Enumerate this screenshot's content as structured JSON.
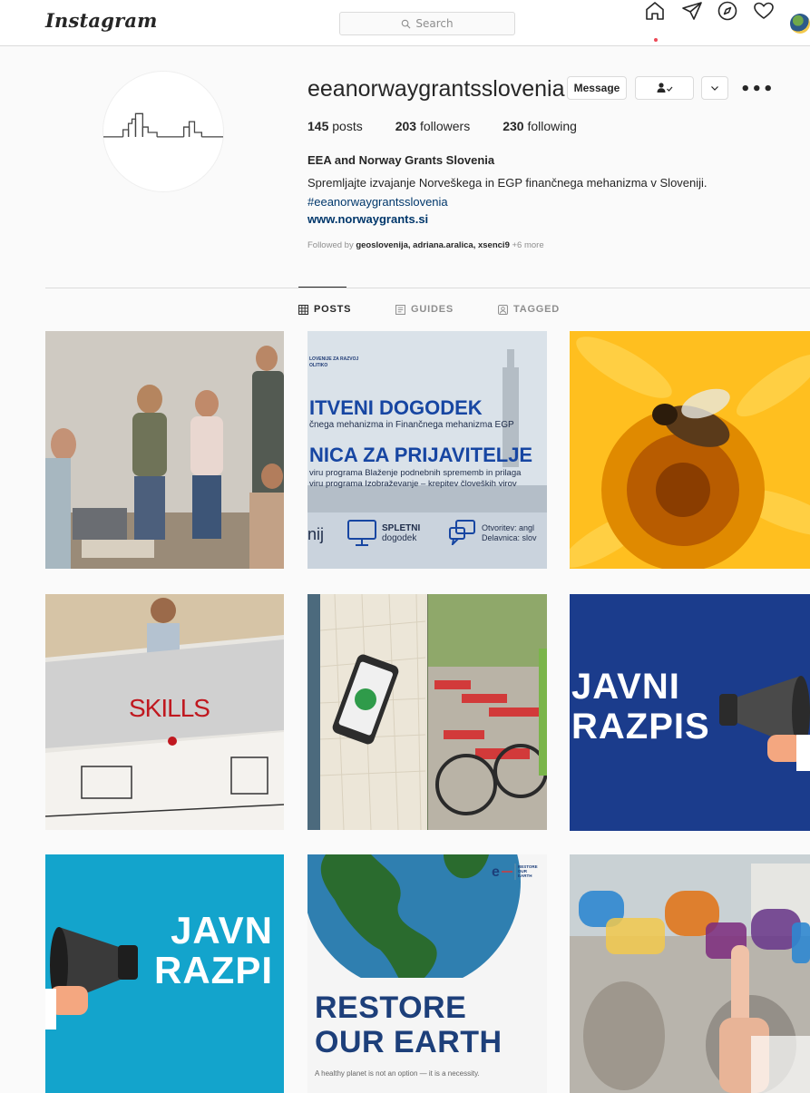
{
  "nav": {
    "logo": "Instagram",
    "search_placeholder": "Search"
  },
  "profile": {
    "username": "eeanorwaygrantsslovenia",
    "message_label": "Message",
    "posts_count": "145",
    "posts_label": "posts",
    "followers_count": "203",
    "followers_label": "followers",
    "following_count": "230",
    "following_label": "following",
    "full_name": "EEA and Norway Grants Slovenia",
    "bio_line": "Spremljajte izvajanje Norveškega in EGP finančnega mehanizma v Sloveniji.",
    "hashtag": "#eeanorwaygrantsslovenia",
    "website": "www.norwaygrants.si",
    "followed_by_prefix": "Followed by",
    "followed_by_users": "geoslovenija, adriana.aralica, xsenci9",
    "followed_by_more": "+6 more"
  },
  "tabs": [
    {
      "label": "POSTS",
      "active": true
    },
    {
      "label": "GUIDES",
      "active": false
    },
    {
      "label": "TAGGED",
      "active": false
    }
  ],
  "posts": {
    "p2": {
      "small": "LOVENIJE ZA RAZVOJ OLITIKO",
      "h1": "ITVENI DOGODEK",
      "s1": "čnega mehanizma in Finančnega mehanizma EGP",
      "h2": "NICA ZA PRIJAVITELJE",
      "s2a": "viru programa Blaženje podnebnih sprememb in prilaga",
      "s2b": "viru programa Izobraževanje – krepitev človeških virov",
      "b0": "nij",
      "b1a": "SPLETNI",
      "b1b": "dogodek",
      "b2a": "Otvoritev: angl",
      "b2b": "Delavnica: slov"
    },
    "p4": {
      "text": "SKILLS"
    },
    "p6": {
      "line1": "JAVNI",
      "line2": "RAZPIS"
    },
    "p7": {
      "line1": "JAVN",
      "line2": "RAZPI"
    },
    "p8": {
      "line1": "RESTORE",
      "line2": "OUR EARTH",
      "tagline": "A healthy planet is not an option — it is a necessity.",
      "logo_text": "RESTORE OUR EARTH"
    }
  },
  "colors": {
    "link": "#00376b",
    "border": "#dbdbdb",
    "notification_dot": "#ed4956"
  }
}
